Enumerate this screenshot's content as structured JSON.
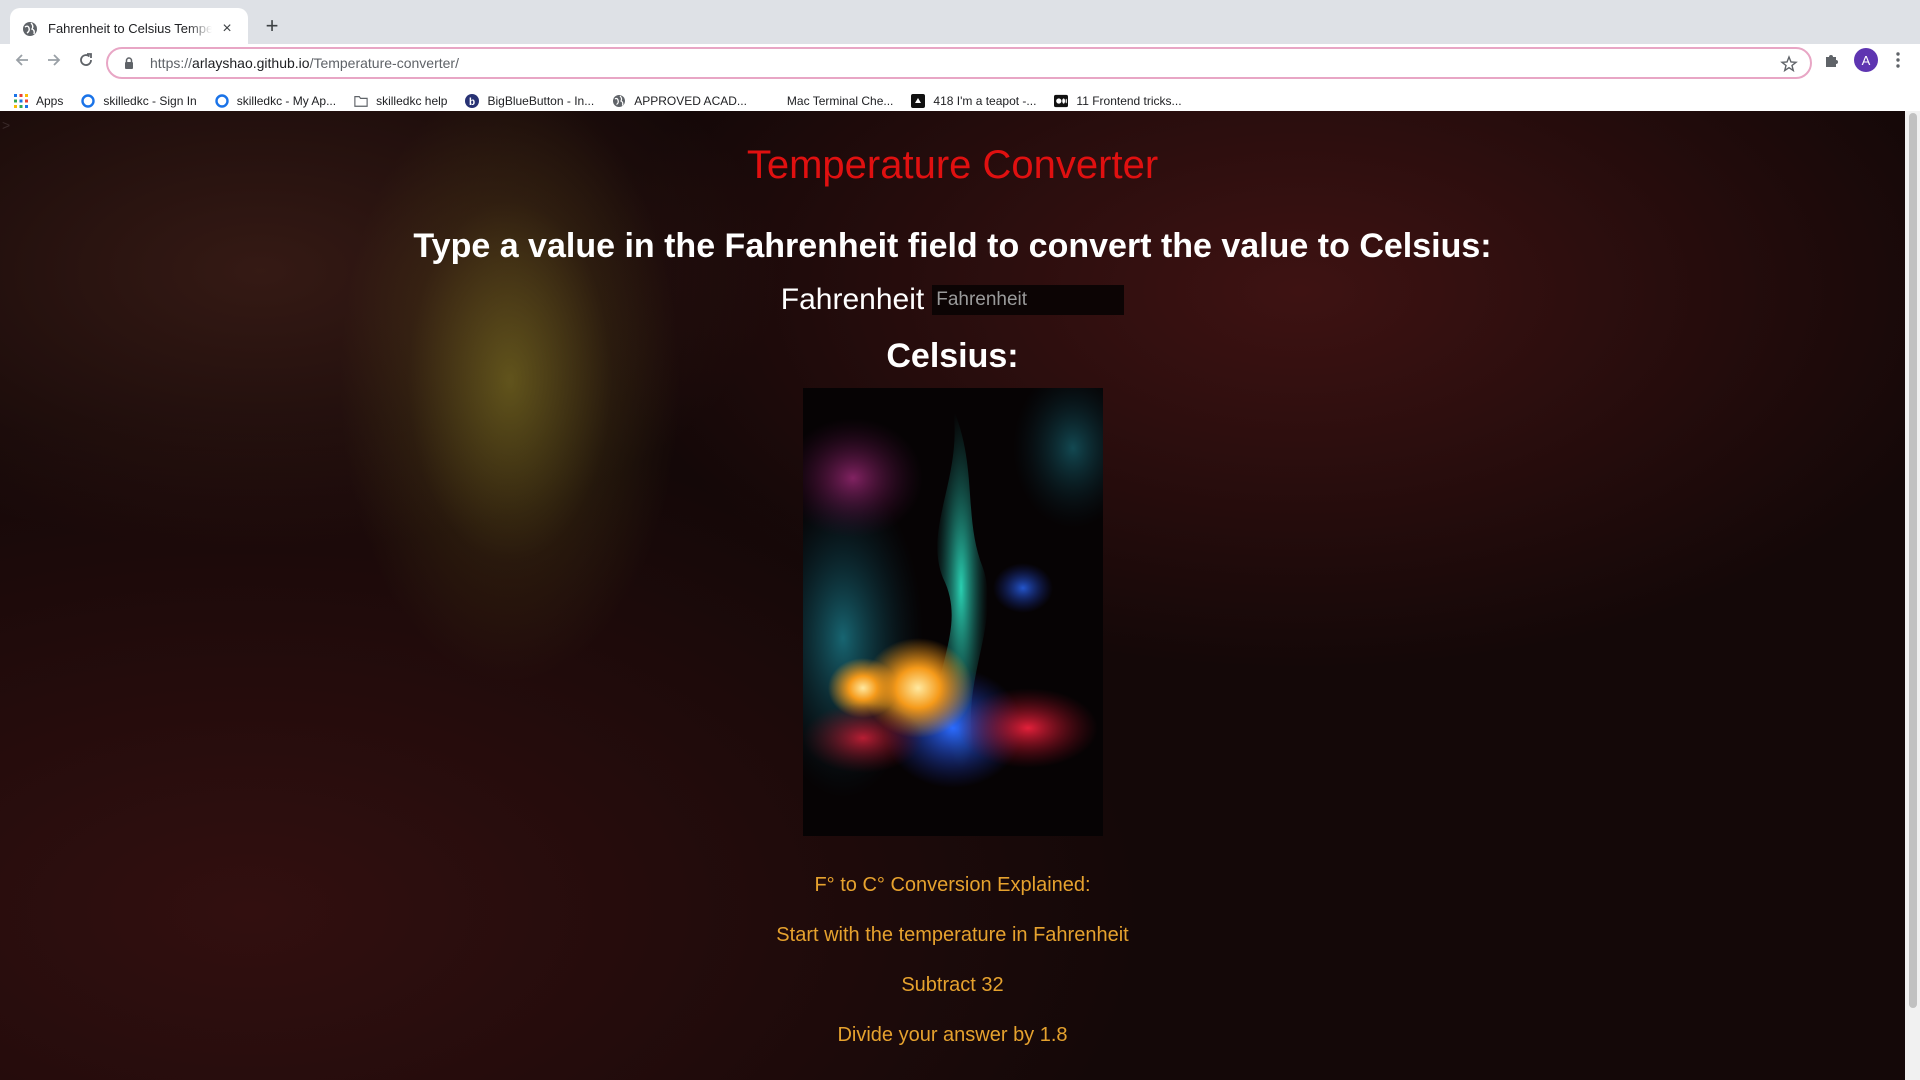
{
  "browser": {
    "tab_title": "Fahrenheit to Celsius Temperature Converter",
    "tab_close": "×",
    "new_tab": "+",
    "url_host": "arlayshao.github.io",
    "url_prefix": "https://",
    "url_path": "/Temperature-converter/",
    "avatar_letter": "A",
    "bookmarks": [
      {
        "label": "Apps",
        "icon": "apps-grid-icon"
      },
      {
        "label": "skilledkc - Sign In",
        "icon": "circle-icon"
      },
      {
        "label": "skilledkc - My Ap...",
        "icon": "circle-icon"
      },
      {
        "label": "skilledkc help",
        "icon": "folder-icon"
      },
      {
        "label": "BigBlueButton - In...",
        "icon": "bbb-icon"
      },
      {
        "label": "APPROVED ACAD...",
        "icon": "globe-icon"
      },
      {
        "label": "Mac Terminal Che...",
        "icon": "apple-icon"
      },
      {
        "label": "418 I'm a teapot -...",
        "icon": "teapot-icon"
      },
      {
        "label": "11 Frontend tricks...",
        "icon": "medium-icon"
      }
    ]
  },
  "page": {
    "corner_mark": ">",
    "title": "Temperature Converter",
    "instruction": "Type a value in the Fahrenheit field to convert the value to Celsius:",
    "fahrenheit_label": "Fahrenheit",
    "fahrenheit_placeholder": "Fahrenheit",
    "fahrenheit_value": "",
    "celsius_label": "Celsius:",
    "explanation": [
      "F° to C° Conversion Explained:",
      "Start with the temperature in Fahrenheit",
      "Subtract 32",
      "Divide your answer by 1.8"
    ]
  },
  "colors": {
    "title": "#e01010",
    "explanation": "#e6a22e",
    "background": "#140808"
  }
}
